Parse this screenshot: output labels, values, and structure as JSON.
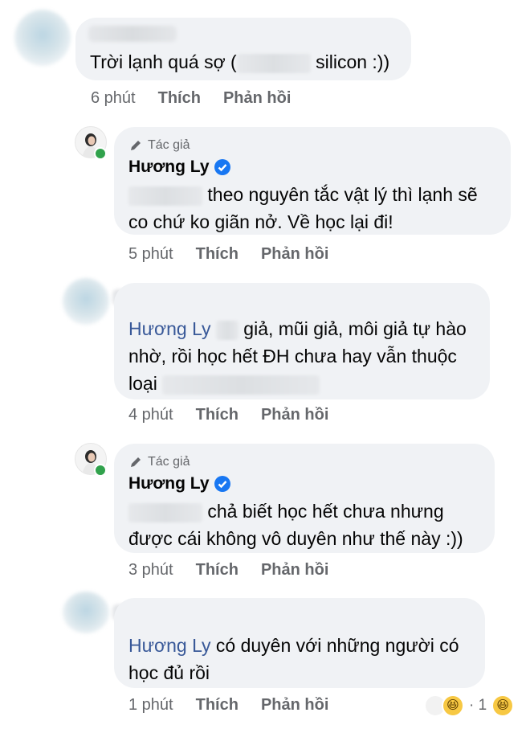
{
  "comments": [
    {
      "time": "6 phút",
      "like": "Thích",
      "reply": "Phản hồi",
      "text_before": "Trời lạnh quá sợ (",
      "text_after": "silicon :))"
    },
    {
      "badge": "Tác giả",
      "name": "Hương Ly",
      "text_line1": "theo nguyên tắc vật lý thì lạnh sẽ",
      "text_line2": "co chứ ko giãn nở. Về học lại đi!",
      "time": "5 phút",
      "like": "Thích",
      "reply": "Phản hồi"
    },
    {
      "mention": "Hương Ly",
      "text_line1": "giả, mũi giả, môi giả tự hào",
      "text_line2": "nhờ, rồi học hết ĐH chưa hay vẫn thuộc",
      "text_line3": "loại",
      "time": "4 phút",
      "like": "Thích",
      "reply": "Phản hồi"
    },
    {
      "badge": "Tác giả",
      "name": "Hương Ly",
      "text_line1": "chả biết học hết chưa nhưng",
      "text_line2": "được cái không vô duyên như thế này :))",
      "time": "3 phút",
      "like": "Thích",
      "reply": "Phản hồi"
    },
    {
      "mention": "Hương Ly",
      "text_line1": "có duyên với những người có",
      "text_line2": "học đủ rồi",
      "time": "1 phút",
      "like": "Thích",
      "reply": "Phản hồi",
      "reaction_count": "· 1",
      "reaction_icons": [
        "haha-emoji",
        "haha-emoji"
      ]
    }
  ],
  "colors": {
    "bubble": "#f0f2f5",
    "mention": "#385898",
    "verified": "#1877f2",
    "meta": "#65676b"
  }
}
